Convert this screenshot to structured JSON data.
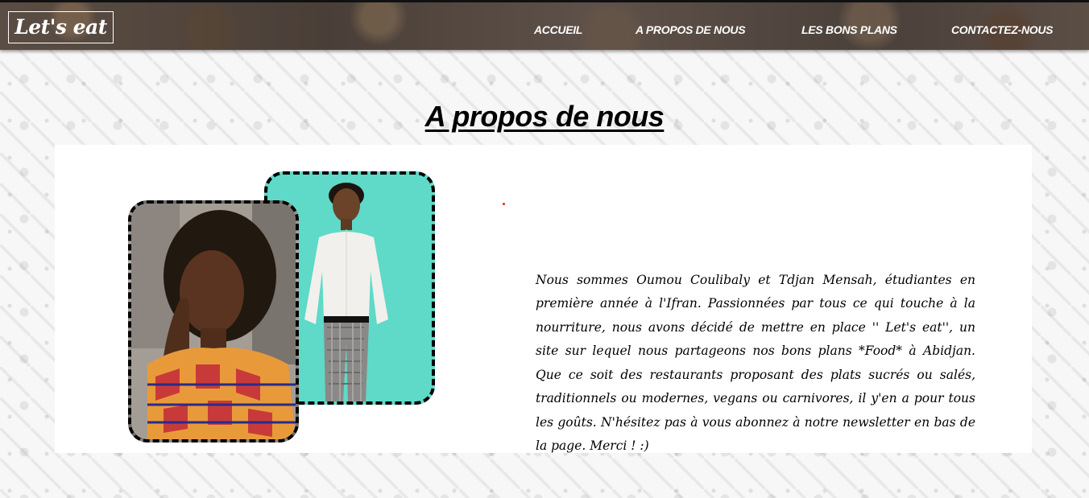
{
  "header": {
    "logo": "Let's eat",
    "nav": [
      {
        "label": "ACCUEIL"
      },
      {
        "label": "A PROPOS DE NOUS"
      },
      {
        "label": "LES BONS PLANS"
      },
      {
        "label": "CONTACTEZ-NOUS"
      }
    ]
  },
  "main": {
    "title": "A propos de nous",
    "about_text": "Nous sommes Oumou Coulibaly et Tdjan Mensah, étudiantes en première année à l'Ifran. Passionnées par tous ce qui touche à la nourriture, nous avons décidé de mettre en place '' Let's eat'', un site sur lequel nous partageons nos bons plans *Food* à Abidjan. Que ce soit des restaurants proposant des plats sucrés ou salés, traditionnels ou modernes, vegans ou carnivores, il y'en a pour tous les goûts. N'hésitez pas à vous abonnez à notre newsletter en bas de la page. Merci ! :)"
  },
  "colors": {
    "photo_back_bg": "#5fd9c8",
    "accent_dot": "#dd2222"
  }
}
